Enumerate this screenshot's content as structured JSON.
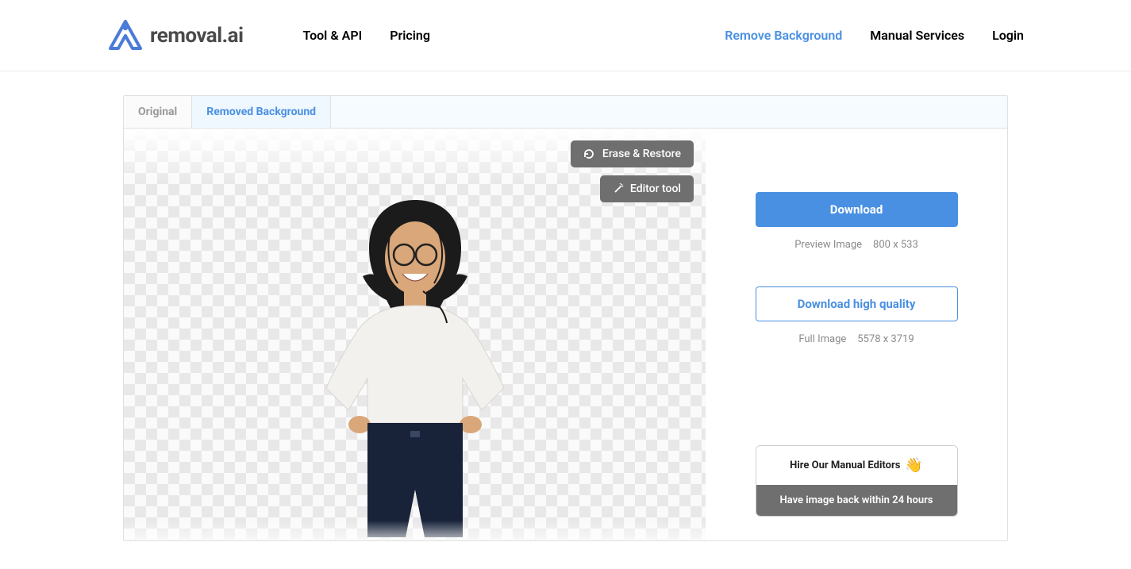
{
  "brand": {
    "name": "removal",
    "suffix": ".ai"
  },
  "nav": {
    "left": [
      {
        "label": "Tool & API"
      },
      {
        "label": "Pricing"
      }
    ],
    "right": [
      {
        "label": "Remove Background",
        "active": true
      },
      {
        "label": "Manual Services"
      },
      {
        "label": "Login"
      }
    ]
  },
  "tabs": {
    "original": "Original",
    "removed": "Removed Background"
  },
  "image_actions": {
    "erase_restore": "Erase & Restore",
    "editor_tool": "Editor tool"
  },
  "downloads": {
    "preview": {
      "button": "Download",
      "caption_label": "Preview Image",
      "dimensions": "800 x 533"
    },
    "full": {
      "button": "Download high quality",
      "caption_label": "Full Image",
      "dimensions": "5578 x 3719"
    }
  },
  "hire": {
    "title": "Hire Our Manual Editors",
    "subtitle": "Have image back within 24 hours"
  }
}
